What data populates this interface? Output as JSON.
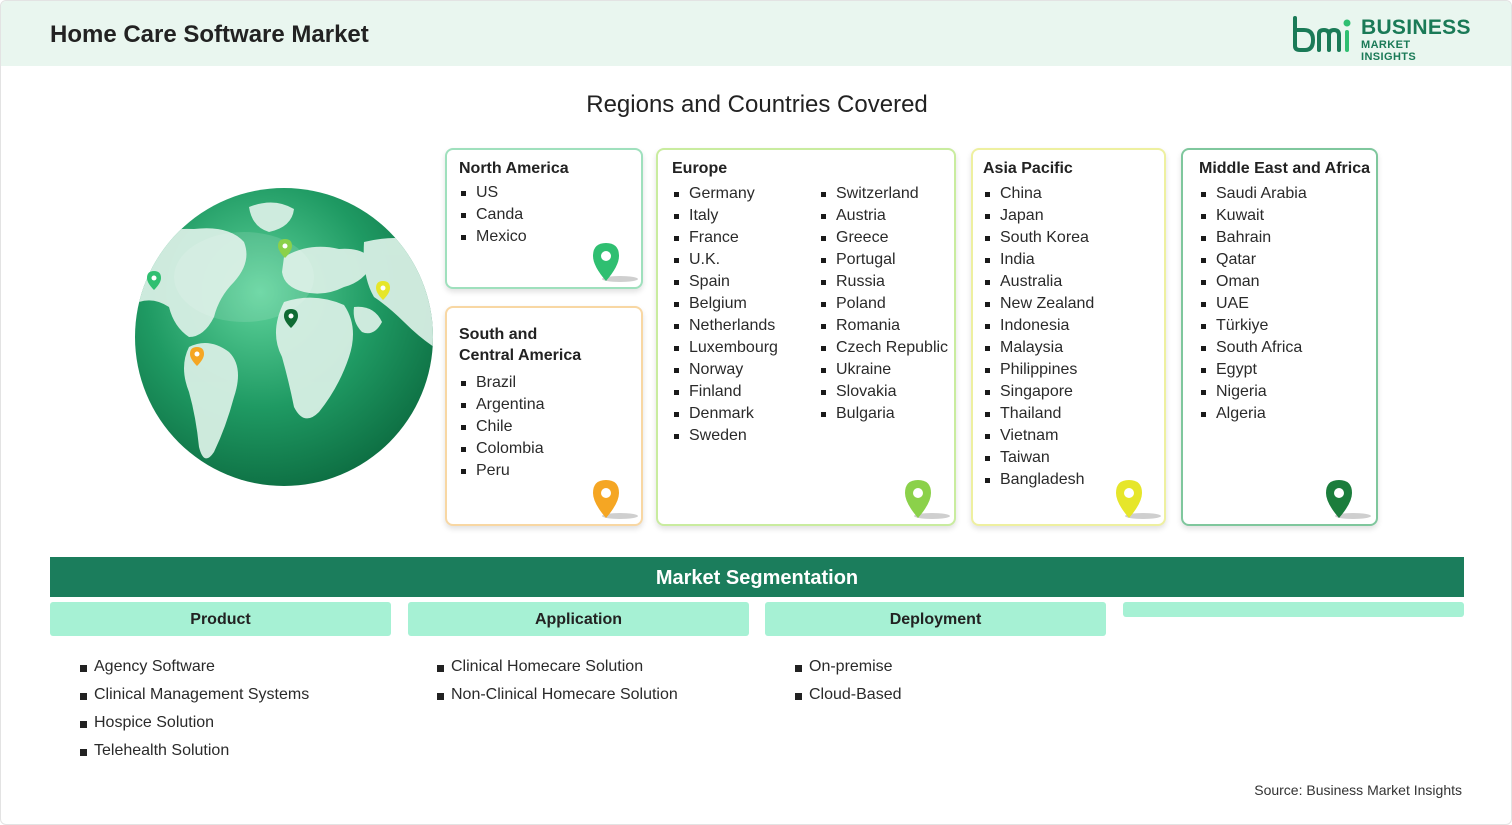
{
  "header": {
    "title": "Home Care Software Market",
    "logo_line1": "BUSINESS",
    "logo_line2": "MARKET INSIGHTS"
  },
  "subtitle": "Regions and Countries Covered",
  "regions": {
    "north_america": {
      "title": "North America",
      "items": [
        "US",
        "Canda",
        "Mexico"
      ],
      "color": "#2fbf71"
    },
    "south_central_america": {
      "title_line1": "South and",
      "title_line2": "Central America",
      "items": [
        "Brazil",
        "Argentina",
        "Chile",
        "Colombia",
        "Peru"
      ],
      "color": "#f5a623"
    },
    "europe": {
      "title": "Europe",
      "col1": [
        "Germany",
        "Italy",
        "France",
        "U.K.",
        "Spain",
        "Belgium",
        "Netherlands",
        "Luxembourg",
        "Norway",
        "Finland",
        "Denmark",
        "Sweden"
      ],
      "col2": [
        "Switzerland",
        "Austria",
        "Greece",
        "Portugal",
        "Russia",
        "Poland",
        "Romania",
        "Czech Republic",
        "Ukraine",
        "Slovakia",
        "Bulgaria"
      ],
      "color": "#8bd14a"
    },
    "asia_pacific": {
      "title": "Asia Pacific",
      "items": [
        "China",
        "Japan",
        "South Korea",
        "India",
        "Australia",
        "New Zealand",
        "Indonesia",
        "Malaysia",
        "Philippines",
        "Singapore",
        "Thailand",
        "Vietnam",
        "Taiwan",
        "Bangladesh"
      ],
      "color": "#e6e62a"
    },
    "mea": {
      "title": "Middle East and Africa",
      "items": [
        "Saudi Arabia",
        "Kuwait",
        "Bahrain",
        "Qatar",
        "Oman",
        "UAE",
        "Türkiye",
        "South Africa",
        "Egypt",
        "Nigeria",
        "Algeria"
      ],
      "color": "#1b7d3c"
    }
  },
  "segmentation": {
    "title": "Market Segmentation",
    "columns": [
      {
        "header": "Product",
        "items": [
          "Agency Software",
          "Clinical Management Systems",
          "Hospice Solution",
          "Telehealth Solution"
        ]
      },
      {
        "header": "Application",
        "items": [
          "Clinical Homecare Solution",
          "Non-Clinical Homecare Solution"
        ]
      },
      {
        "header": "Deployment",
        "items": [
          "On-premise",
          "Cloud-Based"
        ]
      }
    ]
  },
  "source": "Source: Business Market Insights",
  "colors": {
    "header_bg": "#e9f6ef",
    "brand_green": "#1b7d5c",
    "segment_header_bg": "#a6f1d4"
  }
}
